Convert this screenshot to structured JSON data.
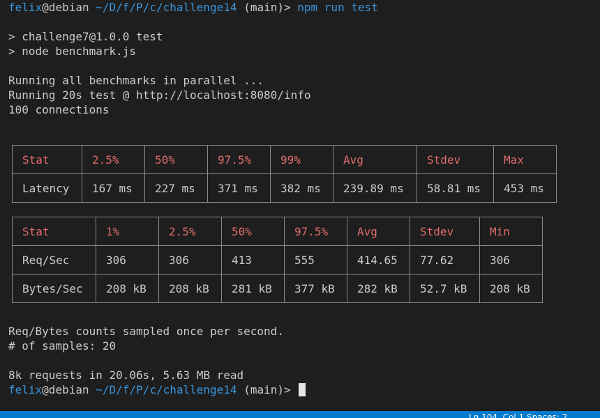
{
  "prompt": {
    "user": "felix",
    "host": "@debian",
    "path": "~/D/f/P/c/challenge14",
    "branch": "(main)>",
    "command": "npm run test"
  },
  "output": {
    "npm_line1": "> challenge7@1.0.0 test",
    "npm_line2": "> node benchmark.js",
    "running_all": "Running all benchmarks in parallel ...",
    "running_test": "Running 20s test @ http://localhost:8080/info",
    "connections": "100 connections",
    "sampled_note": "Req/Bytes counts sampled once per second.",
    "samples": "# of samples: 20",
    "summary": "8k requests in 20.06s, 5.63 MB read"
  },
  "latency_table": {
    "headers": [
      "Stat",
      "2.5%",
      "50%",
      "97.5%",
      "99%",
      "Avg",
      "Stdev",
      "Max"
    ],
    "rows": [
      [
        "Latency",
        "167 ms",
        "227 ms",
        "371 ms",
        "382 ms",
        "239.89 ms",
        "58.81 ms",
        "453 ms"
      ]
    ]
  },
  "throughput_table": {
    "headers": [
      "Stat",
      "1%",
      "2.5%",
      "50%",
      "97.5%",
      "Avg",
      "Stdev",
      "Min"
    ],
    "rows": [
      [
        "Req/Sec",
        "306",
        "306",
        "413",
        "555",
        "414.65",
        "77.62",
        "306"
      ],
      [
        "Bytes/Sec",
        "208 kB",
        "208 kB",
        "281 kB",
        "377 kB",
        "282 kB",
        "52.7 kB",
        "208 kB"
      ]
    ]
  },
  "status_bar": {
    "text": "Ln 104, Col 1   Spaces: 2"
  },
  "colors": {
    "background": "#1e1e1e",
    "prompt_blue": "#3a96dd",
    "header_red": "#e06c6c",
    "status_bar": "#007acc"
  }
}
